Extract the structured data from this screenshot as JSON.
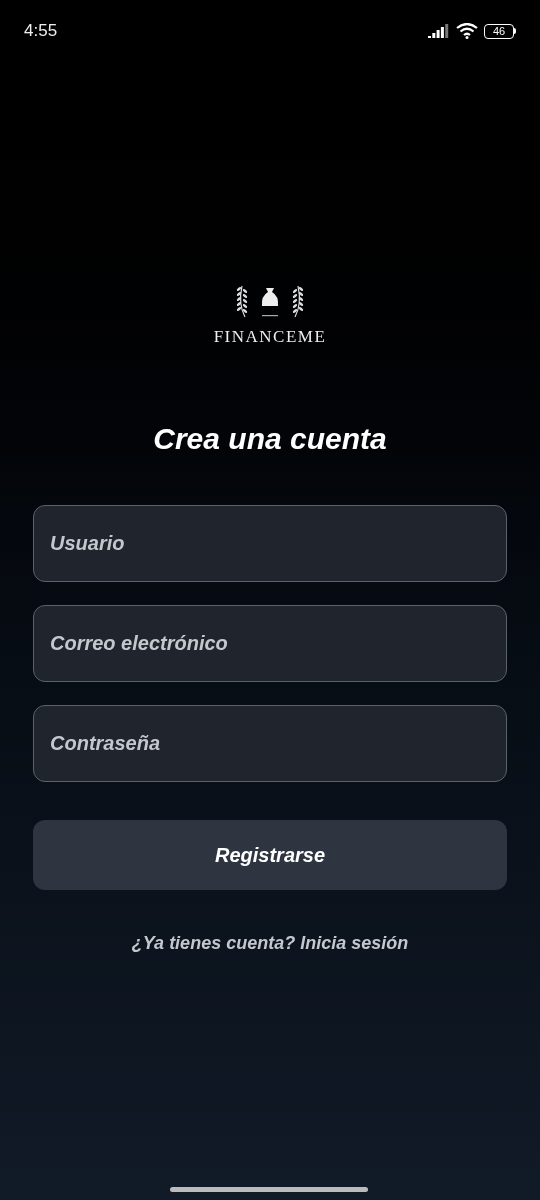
{
  "status_bar": {
    "time": "4:55",
    "battery": "46"
  },
  "logo": {
    "name": "FINANCEME"
  },
  "title": "Crea una cuenta",
  "fields": [
    {
      "placeholder": "Usuario"
    },
    {
      "placeholder": "Correo electrónico"
    },
    {
      "placeholder": "Contraseña"
    }
  ],
  "submit_button": "Registrarse",
  "login_link": "¿Ya tienes cuenta? Inicia sesión"
}
